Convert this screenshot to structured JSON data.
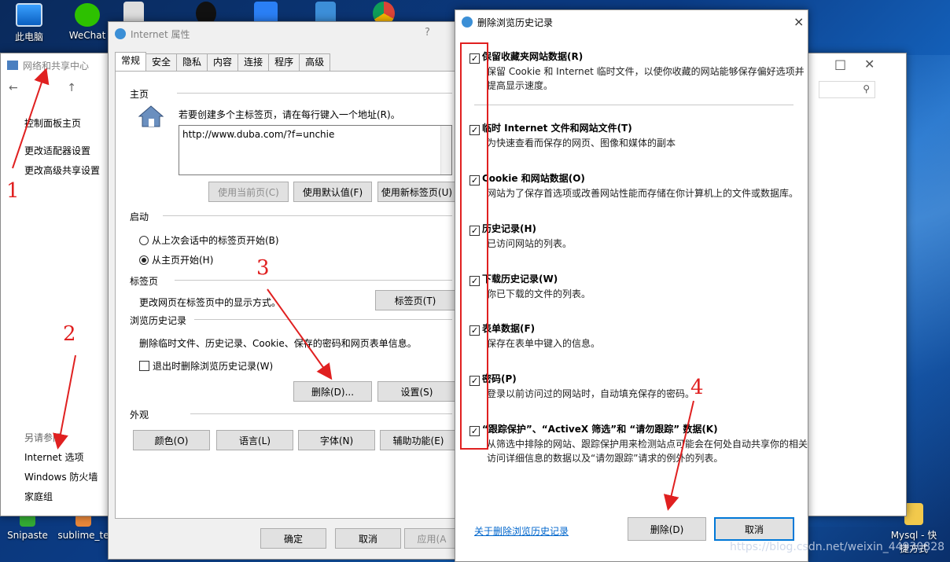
{
  "desktop": {
    "icons": [
      {
        "label": "此电脑",
        "icon": "computer-icon"
      },
      {
        "label": "WeChat",
        "icon": "wechat-icon"
      },
      {
        "label": "Snipaste",
        "icon": "snipaste-icon"
      },
      {
        "label": "sublime_te",
        "icon": "sublime-icon"
      },
      {
        "label": "Mysql - 快",
        "icon": "folder-icon"
      },
      {
        "label": "捷方式",
        "icon": "shortcut-text"
      }
    ]
  },
  "network_window": {
    "title": "网络和共享中心",
    "links": [
      "控制面板主页",
      "更改适配器设置",
      "更改高级共享设置"
    ],
    "see_also": "另请参阅",
    "see_also_links": [
      "Internet 选项",
      "Windows 防火墙",
      "家庭组"
    ]
  },
  "internet_options": {
    "title": "Internet 属性",
    "help": "?",
    "tabs": [
      "常规",
      "安全",
      "隐私",
      "内容",
      "连接",
      "程序",
      "高级"
    ],
    "home": {
      "section": "主页",
      "hint": "若要创建多个主标签页，请在每行键入一个地址(R)。",
      "url": "http://www.duba.com/?f=unchie",
      "buttons": [
        "使用当前页(C)",
        "使用默认值(F)",
        "使用新标签页(U)"
      ]
    },
    "startup": {
      "section": "启动",
      "options": [
        "从上次会话中的标签页开始(B)",
        "从主页开始(H)"
      ]
    },
    "tabs_section": {
      "section": "标签页",
      "desc": "更改网页在标签页中的显示方式。",
      "button": "标签页(T)"
    },
    "history": {
      "section": "浏览历史记录",
      "desc": "删除临时文件、历史记录、Cookie、保存的密码和网页表单信息。",
      "exit_checkbox": "退出时删除浏览历史记录(W)",
      "delete_button": "删除(D)...",
      "settings_button": "设置(S)"
    },
    "appearance": {
      "section": "外观",
      "buttons": [
        "颜色(O)",
        "语言(L)",
        "字体(N)",
        "辅助功能(E)"
      ]
    },
    "footer": [
      "确定",
      "取消",
      "应用(A"
    ]
  },
  "delete_dialog": {
    "title": "删除浏览历史记录",
    "close": "×",
    "items": [
      {
        "title": "保留收藏夹网站数据(R)",
        "desc": "保留 Cookie 和 Internet 临时文件，以使你收藏的网站能够保存偏好选项并提高显示速度。",
        "checked": true
      },
      {
        "title": "临时 Internet 文件和网站文件(T)",
        "desc": "为快速查看而保存的网页、图像和媒体的副本",
        "checked": true
      },
      {
        "title": "Cookie 和网站数据(O)",
        "desc": "网站为了保存首选项或改善网站性能而存储在你计算机上的文件或数据库。",
        "checked": true
      },
      {
        "title": "历史记录(H)",
        "desc": "已访问网站的列表。",
        "checked": true
      },
      {
        "title": "下载历史记录(W)",
        "desc": "你已下载的文件的列表。",
        "checked": true
      },
      {
        "title": "表单数据(F)",
        "desc": "保存在表单中键入的信息。",
        "checked": true
      },
      {
        "title": "密码(P)",
        "desc": "登录以前访问过的网站时，自动填充保存的密码。",
        "checked": true
      },
      {
        "title": "“跟踪保护”、“ActiveX 筛选”和 “请勿跟踪” 数据(K)",
        "desc": "从筛选中排除的网站、跟踪保护用来检测站点可能会在何处自动共享你的相关访问详细信息的数据以及“请勿跟踪”请求的例外的列表。",
        "checked": true
      }
    ],
    "about_link": "关于删除浏览历史记录",
    "delete_button": "删除(D)",
    "cancel_button": "取消"
  },
  "annotations": [
    "1",
    "2",
    "3",
    "4"
  ],
  "watermark": "https://blog.csdn.net/weixin_44930828",
  "colors": {
    "annotation": "#e02020",
    "link": "#0066cc",
    "focus": "#0078d7"
  }
}
